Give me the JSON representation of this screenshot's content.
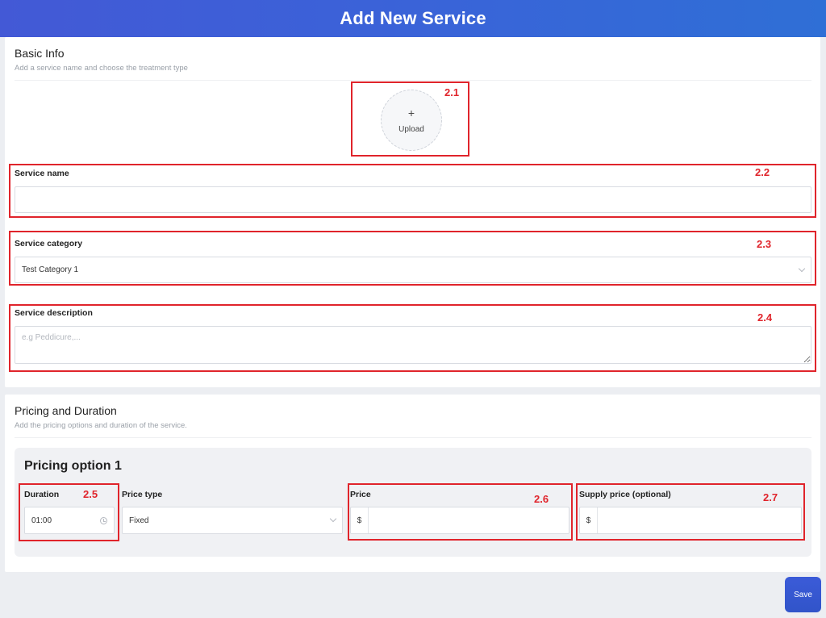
{
  "header": {
    "title": "Add New Service"
  },
  "basic_info": {
    "title": "Basic Info",
    "subtitle": "Add a service name and choose the treatment type",
    "upload": {
      "plus": "+",
      "label": "Upload"
    },
    "service_name": {
      "label": "Service name",
      "value": ""
    },
    "service_category": {
      "label": "Service category",
      "value": "Test Category 1"
    },
    "service_description": {
      "label": "Service description",
      "placeholder": "e.g Peddicure,..."
    }
  },
  "pricing": {
    "title": "Pricing and Duration",
    "subtitle": "Add the pricing options and duration of the service.",
    "option_title": "Pricing option 1",
    "duration": {
      "label": "Duration",
      "value": "01:00"
    },
    "price_type": {
      "label": "Price type",
      "value": "Fixed"
    },
    "price": {
      "label": "Price",
      "currency": "$",
      "value": ""
    },
    "supply_price": {
      "label": "Supply price (optional)",
      "currency": "$",
      "value": ""
    }
  },
  "annotations": [
    "2.1",
    "2.2",
    "2.3",
    "2.4",
    "2.5",
    "2.6",
    "2.7"
  ],
  "actions": {
    "save_label": "Save"
  },
  "colors": {
    "accent": "#3b5bd8",
    "annotation": "#e0242b"
  },
  "icons": {
    "upload": "plus-icon",
    "select": "chevron-down-icon",
    "time": "clock-icon"
  }
}
